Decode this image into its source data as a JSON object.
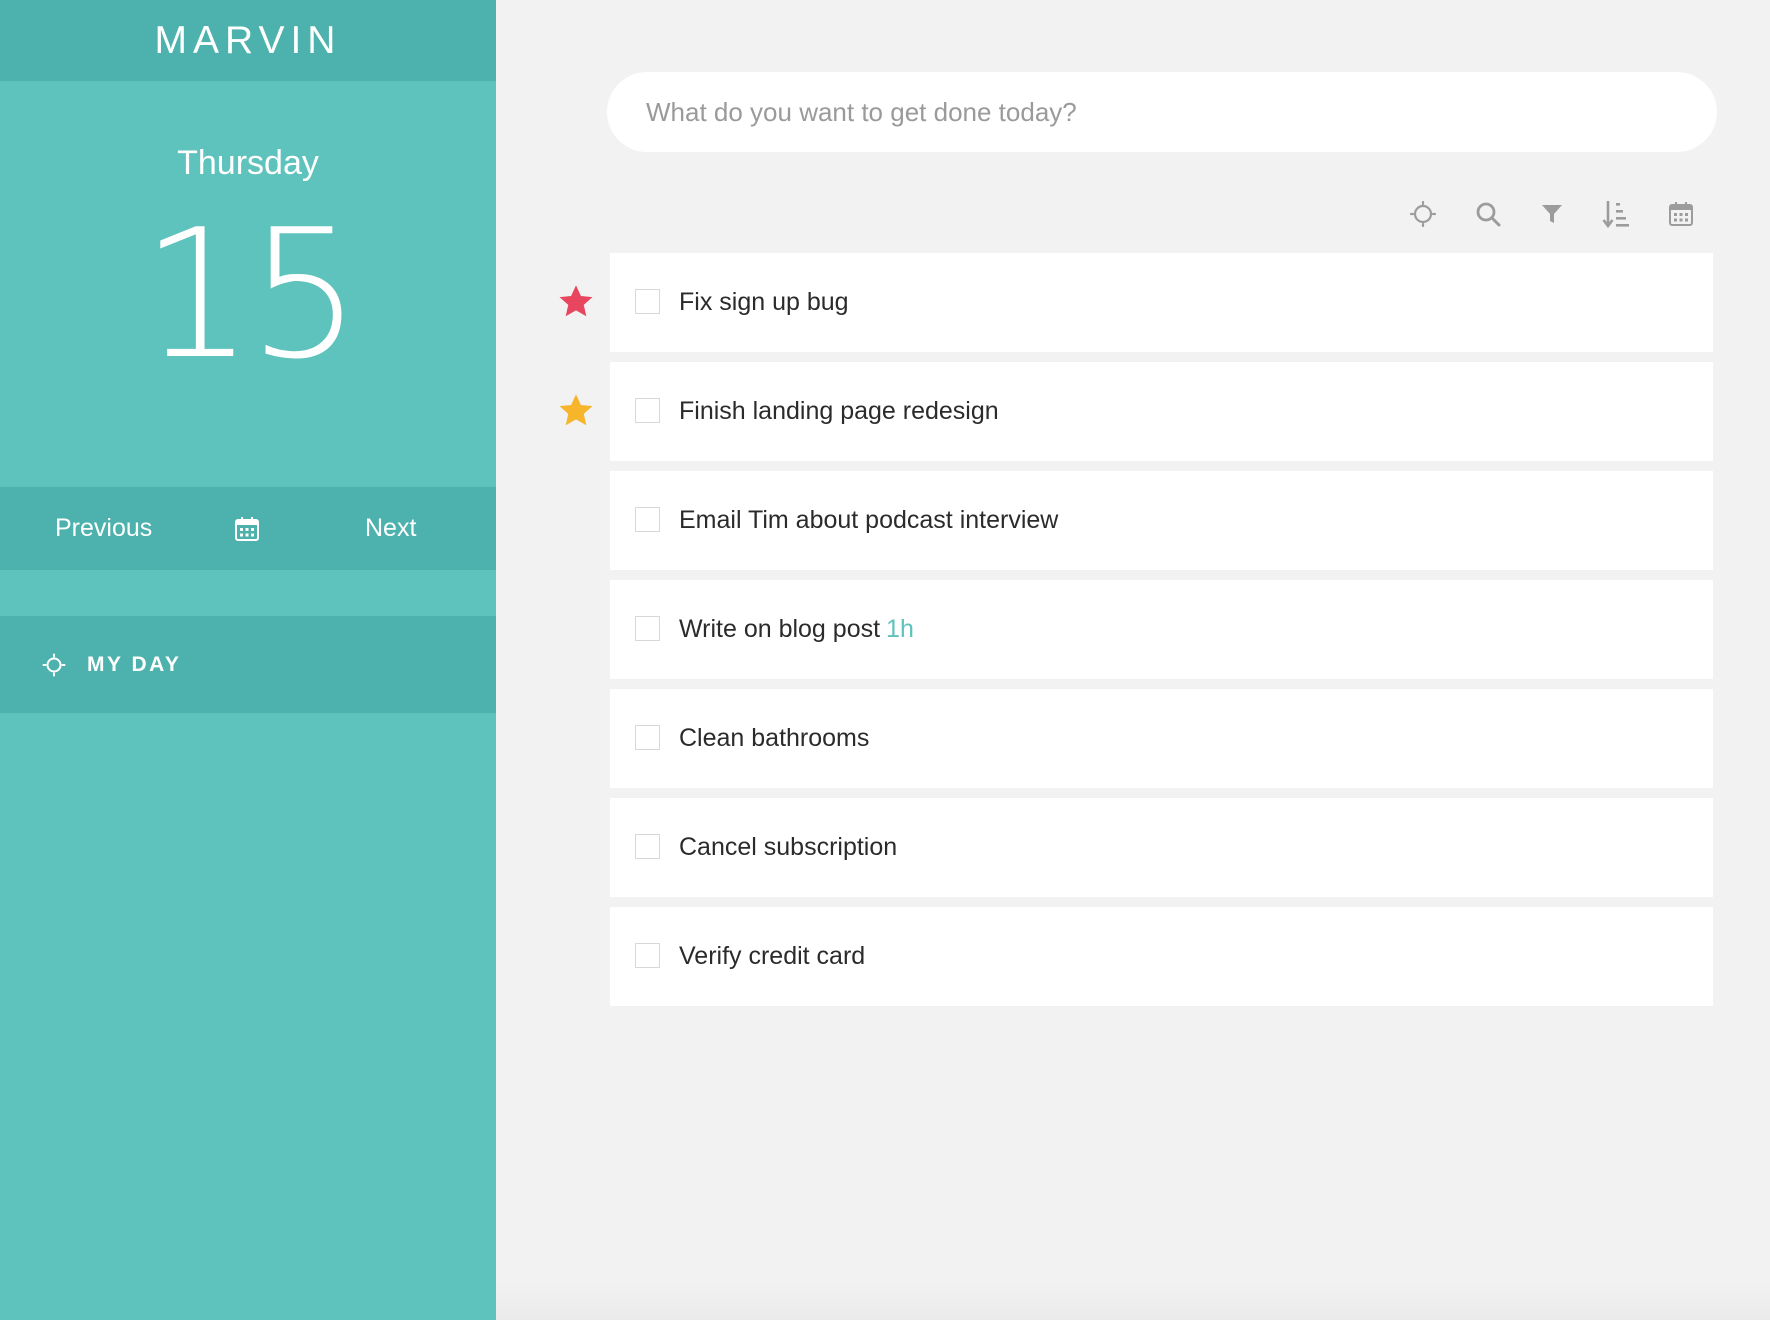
{
  "app": {
    "name": "MARVIN"
  },
  "sidebar": {
    "weekday": "Thursday",
    "day_number": "15",
    "nav": {
      "previous": "Previous",
      "next": "Next",
      "calendar_icon": "calendar-icon"
    },
    "section": {
      "label": "MY DAY",
      "icon": "sun-icon"
    }
  },
  "main": {
    "input": {
      "placeholder": "What do you want to get done today?",
      "value": ""
    },
    "toolbar": [
      "sun-icon",
      "search-icon",
      "filter-icon",
      "sort-icon",
      "calendar-icon"
    ],
    "tasks": [
      {
        "title": "Fix sign up bug",
        "star": "red",
        "duration": ""
      },
      {
        "title": "Finish landing page redesign",
        "star": "yellow",
        "duration": ""
      },
      {
        "title": "Email Tim about podcast interview",
        "star": "",
        "duration": ""
      },
      {
        "title": "Write on blog post",
        "star": "",
        "duration": "1h"
      },
      {
        "title": "Clean bathrooms",
        "star": "",
        "duration": ""
      },
      {
        "title": "Cancel subscription",
        "star": "",
        "duration": ""
      },
      {
        "title": "Verify credit card",
        "star": "",
        "duration": ""
      }
    ]
  },
  "colors": {
    "accent": "#5ec2bd",
    "accent_dark": "#4db2ad",
    "background": "#f1f2f1",
    "star_red": "#e8465e",
    "star_yellow": "#f7b52c"
  }
}
